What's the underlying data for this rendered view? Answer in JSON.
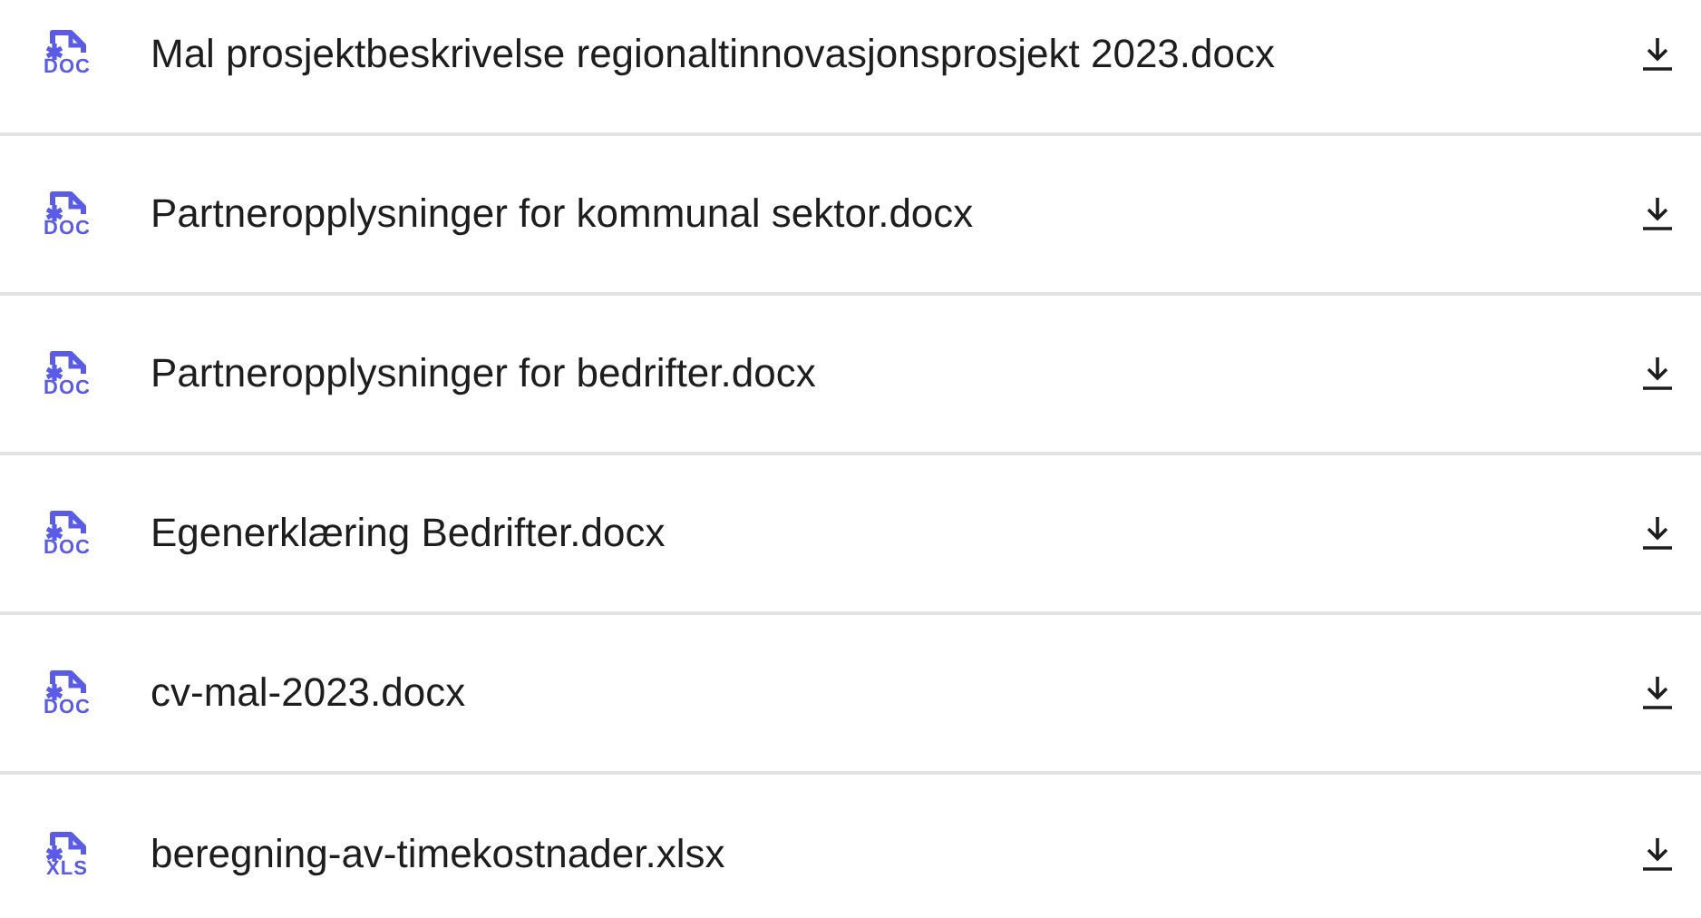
{
  "files": [
    {
      "name": "Mal prosjektbeskrivelse regionaltinnovasjonsprosjekt 2023.docx",
      "type": "DOC"
    },
    {
      "name": "Partneropplysninger for kommunal sektor.docx",
      "type": "DOC"
    },
    {
      "name": "Partneropplysninger for bedrifter.docx",
      "type": "DOC"
    },
    {
      "name": "Egenerklæring Bedrifter.docx",
      "type": "DOC"
    },
    {
      "name": "cv-mal-2023.docx",
      "type": "DOC"
    },
    {
      "name": "beregning-av-timekostnader.xlsx",
      "type": "XLS"
    }
  ]
}
